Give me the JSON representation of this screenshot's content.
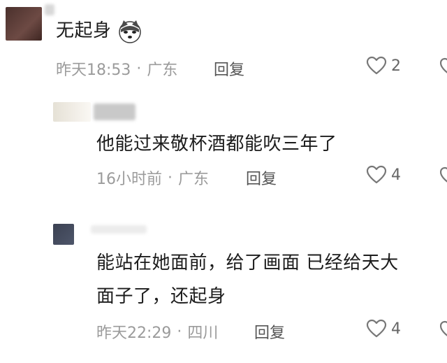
{
  "colors": {
    "text": "#1c1c1c",
    "meta": "#9b9b9b",
    "reply": "#555555",
    "heart_stroke": "#777777"
  },
  "comments": [
    {
      "text_lines": [
        "无起身"
      ],
      "emoji": "husky-dog-emoji",
      "time": "昨天18:53",
      "location": "广东",
      "reply_label": "回复",
      "likes": "2"
    },
    {
      "text_lines": [
        "他能过来敬杯酒都能吹三年了"
      ],
      "time": "16小时前",
      "location": "广东",
      "reply_label": "回复",
      "likes": "4"
    },
    {
      "text_lines": [
        "能站在她面前，给了画面  已经给天大",
        "面子了，还起身"
      ],
      "time": "昨天22:29",
      "location": "四川",
      "reply_label": "回复",
      "likes": "4"
    }
  ],
  "meta_separator": "·"
}
